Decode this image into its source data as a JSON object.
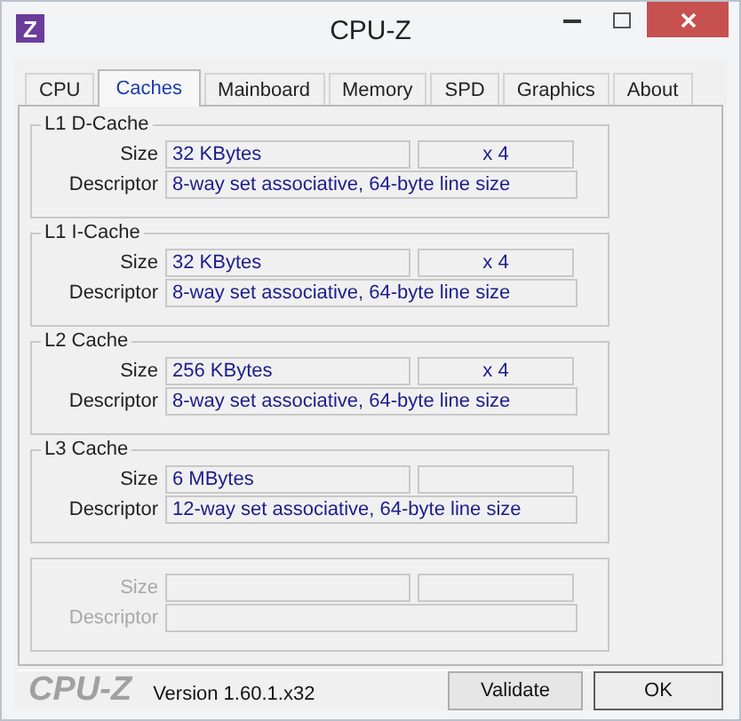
{
  "window": {
    "title": "CPU-Z",
    "icon": "Z"
  },
  "tabs": [
    {
      "label": "CPU",
      "selected": false
    },
    {
      "label": "Caches",
      "selected": true
    },
    {
      "label": "Mainboard",
      "selected": false
    },
    {
      "label": "Memory",
      "selected": false
    },
    {
      "label": "SPD",
      "selected": false
    },
    {
      "label": "Graphics",
      "selected": false
    },
    {
      "label": "About",
      "selected": false
    }
  ],
  "groups": [
    {
      "title": "L1 D-Cache",
      "disabled": false,
      "size_label": "Size",
      "size": "32 KBytes",
      "count": "x 4",
      "descriptor_label": "Descriptor",
      "descriptor": "8-way set associative, 64-byte line size"
    },
    {
      "title": "L1 I-Cache",
      "disabled": false,
      "size_label": "Size",
      "size": "32 KBytes",
      "count": "x 4",
      "descriptor_label": "Descriptor",
      "descriptor": "8-way set associative, 64-byte line size"
    },
    {
      "title": "L2 Cache",
      "disabled": false,
      "size_label": "Size",
      "size": "256 KBytes",
      "count": "x 4",
      "descriptor_label": "Descriptor",
      "descriptor": "8-way set associative, 64-byte line size"
    },
    {
      "title": "L3 Cache",
      "disabled": false,
      "size_label": "Size",
      "size": "6 MBytes",
      "descriptor_label": "Descriptor",
      "descriptor": "12-way set associative, 64-byte line size"
    },
    {
      "disabled": true,
      "size_label": "Size",
      "descriptor_label": "Descriptor"
    }
  ],
  "footer": {
    "logo": "CPU-Z",
    "version": "Version 1.60.1.x32",
    "buttons": [
      "Validate",
      "OK"
    ]
  }
}
